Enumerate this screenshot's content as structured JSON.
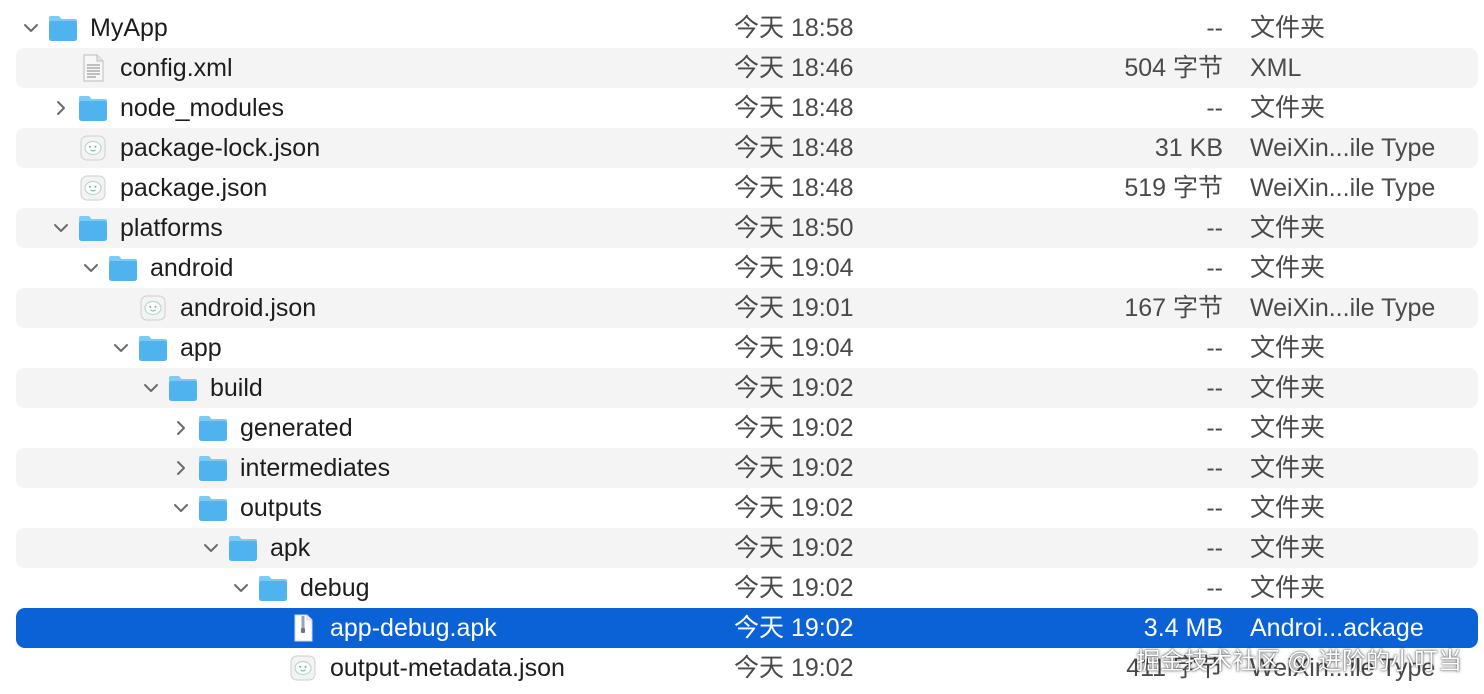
{
  "colors": {
    "folder": "#4fb3f0",
    "folder_tab": "#7ccaf6",
    "selection": "#0a62d6",
    "alt_row": "#f4f4f5"
  },
  "rows": [
    {
      "name": "MyApp",
      "date": "今天 18:58",
      "size": "--",
      "kind": "文件夹",
      "depth": 0,
      "icon": "folder-icon",
      "disclosure": "expanded"
    },
    {
      "name": "config.xml",
      "date": "今天 18:46",
      "size": "504 字节",
      "kind": "XML",
      "depth": 1,
      "icon": "xml-file-icon",
      "disclosure": "none"
    },
    {
      "name": "node_modules",
      "date": "今天 18:48",
      "size": "--",
      "kind": "文件夹",
      "depth": 1,
      "icon": "folder-icon",
      "disclosure": "collapsed"
    },
    {
      "name": "package-lock.json",
      "date": "今天 18:48",
      "size": "31 KB",
      "kind": "WeiXin...ile Type",
      "depth": 1,
      "icon": "json-file-icon",
      "disclosure": "none"
    },
    {
      "name": "package.json",
      "date": "今天 18:48",
      "size": "519 字节",
      "kind": "WeiXin...ile Type",
      "depth": 1,
      "icon": "json-file-icon",
      "disclosure": "none"
    },
    {
      "name": "platforms",
      "date": "今天 18:50",
      "size": "--",
      "kind": "文件夹",
      "depth": 1,
      "icon": "folder-icon",
      "disclosure": "expanded"
    },
    {
      "name": "android",
      "date": "今天 19:04",
      "size": "--",
      "kind": "文件夹",
      "depth": 2,
      "icon": "folder-icon",
      "disclosure": "expanded"
    },
    {
      "name": "android.json",
      "date": "今天 19:01",
      "size": "167 字节",
      "kind": "WeiXin...ile Type",
      "depth": 3,
      "icon": "json-file-icon",
      "disclosure": "none"
    },
    {
      "name": "app",
      "date": "今天 19:04",
      "size": "--",
      "kind": "文件夹",
      "depth": 3,
      "icon": "folder-icon",
      "disclosure": "expanded"
    },
    {
      "name": "build",
      "date": "今天 19:02",
      "size": "--",
      "kind": "文件夹",
      "depth": 4,
      "icon": "folder-icon",
      "disclosure": "expanded"
    },
    {
      "name": "generated",
      "date": "今天 19:02",
      "size": "--",
      "kind": "文件夹",
      "depth": 5,
      "icon": "folder-icon",
      "disclosure": "collapsed"
    },
    {
      "name": "intermediates",
      "date": "今天 19:02",
      "size": "--",
      "kind": "文件夹",
      "depth": 5,
      "icon": "folder-icon",
      "disclosure": "collapsed"
    },
    {
      "name": "outputs",
      "date": "今天 19:02",
      "size": "--",
      "kind": "文件夹",
      "depth": 5,
      "icon": "folder-icon",
      "disclosure": "expanded"
    },
    {
      "name": "apk",
      "date": "今天 19:02",
      "size": "--",
      "kind": "文件夹",
      "depth": 6,
      "icon": "folder-icon",
      "disclosure": "expanded"
    },
    {
      "name": "debug",
      "date": "今天 19:02",
      "size": "--",
      "kind": "文件夹",
      "depth": 7,
      "icon": "folder-icon",
      "disclosure": "expanded"
    },
    {
      "name": "app-debug.apk",
      "date": "今天 19:02",
      "size": "3.4 MB",
      "kind": "Androi...ackage",
      "depth": 8,
      "icon": "apk-file-icon",
      "disclosure": "none",
      "selected": true
    },
    {
      "name": "output-metadata.json",
      "date": "今天 19:02",
      "size": "411 字节",
      "kind": "WeiXin...ile Type",
      "depth": 8,
      "icon": "json-file-icon",
      "disclosure": "none"
    }
  ],
  "watermark": "掘金技术社区 @ 进阶的小叮当"
}
